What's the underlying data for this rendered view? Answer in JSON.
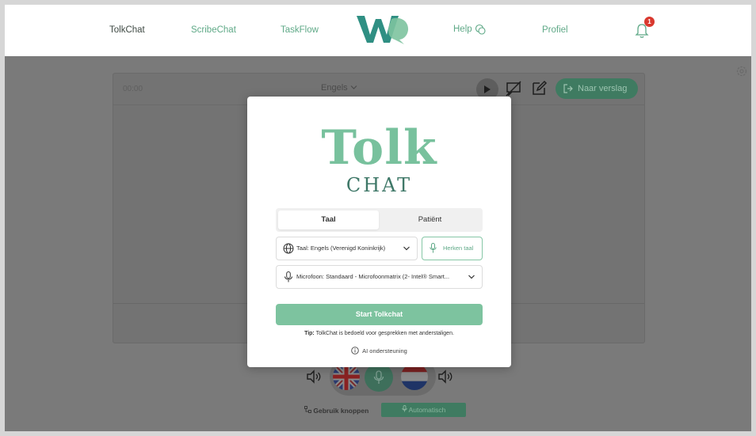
{
  "nav": {
    "items": [
      "TolkChat",
      "ScribeChat",
      "TaskFlow",
      "Help",
      "Profiel"
    ],
    "notification_count": "1"
  },
  "background": {
    "time": "00:00",
    "language": "Engels",
    "report_button": "Naar verslag",
    "use_buttons": "Gebruik knoppen",
    "automatic": "Automatisch"
  },
  "modal": {
    "brand_main": "Tolk",
    "brand_sub": "CHAT",
    "tabs": [
      "Taal",
      "Patiënt"
    ],
    "language_select": "Taal: Engels (Verenigd Koninkrijk)",
    "detect_language": "Herken taal",
    "microphone_select": "Microfoon: Standaard - Microfoonmatrix (2- Intel® Smart...",
    "start_button": "Start Tolkchat",
    "tip_label": "Tip:",
    "tip_text": "TolkChat is bedoeld voor gesprekken met anderstaligen.",
    "ai_support": "AI ondersteuning"
  },
  "colors": {
    "accent": "#78c19d",
    "accent_dark": "#3f7868",
    "badge": "#d9382e"
  }
}
